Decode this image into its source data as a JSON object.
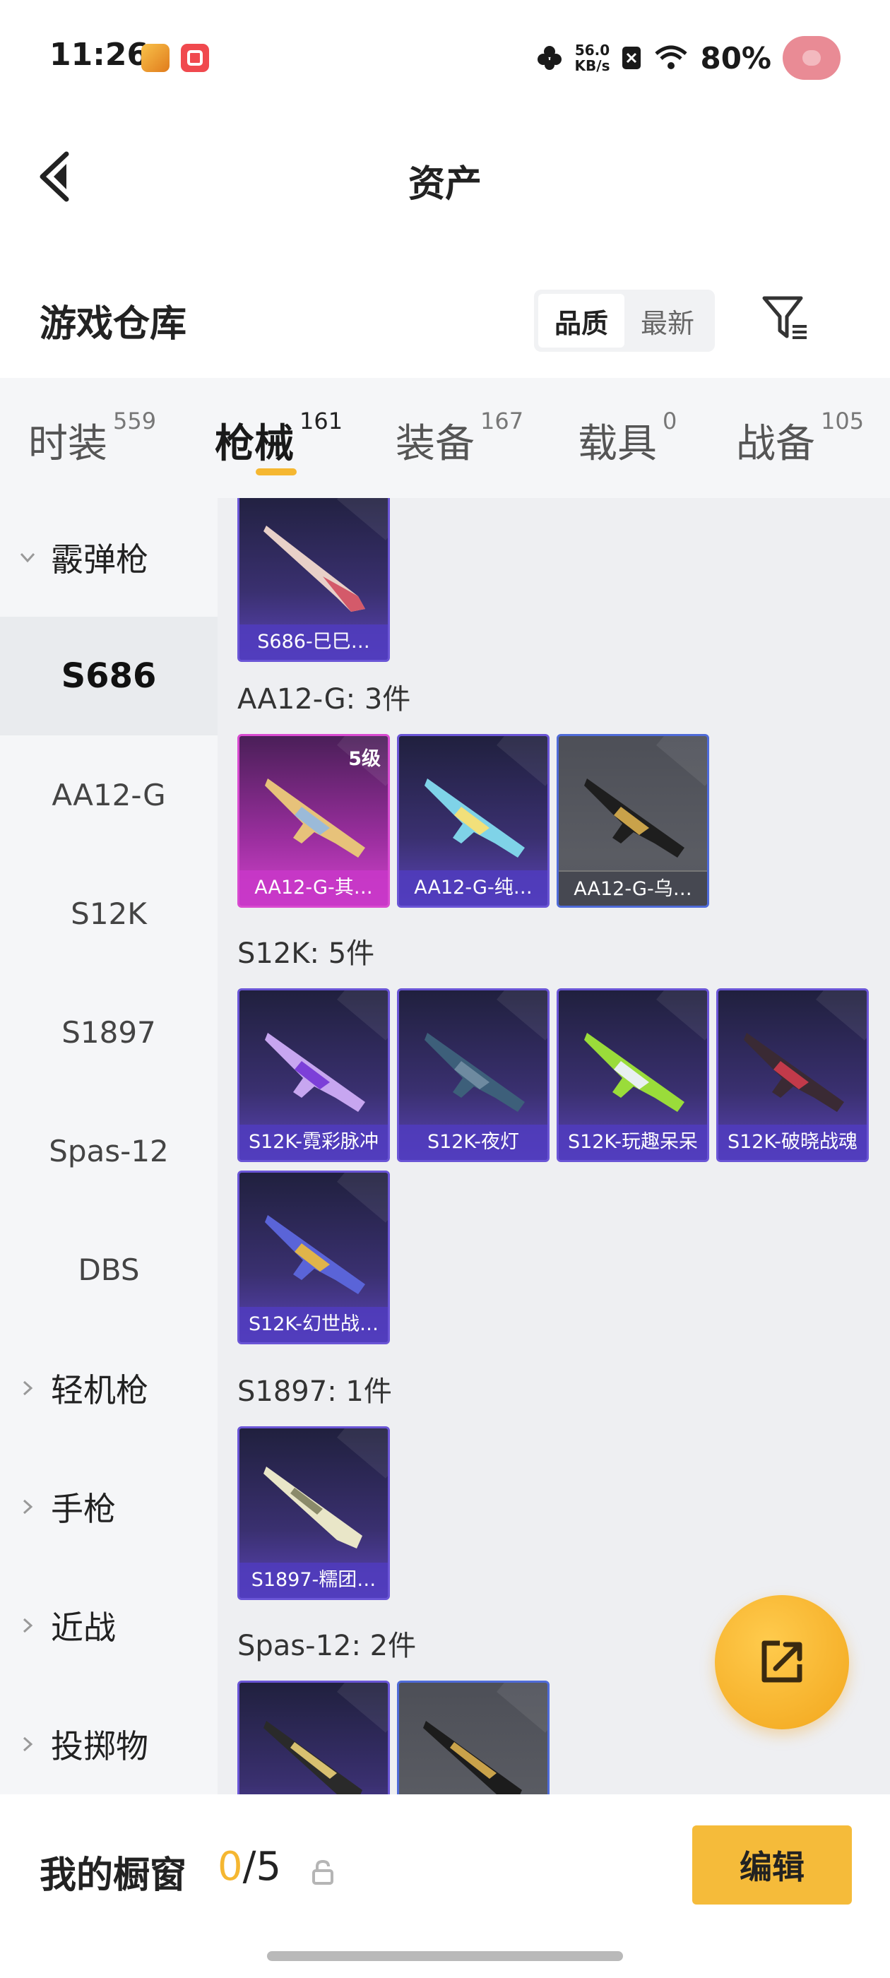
{
  "status_bar": {
    "time": "11:26",
    "net_speed_value": "56.0",
    "net_speed_unit": "KB/s",
    "battery": "80%"
  },
  "header": {
    "title": "资产",
    "back_icon": "chevron-left-icon"
  },
  "section": {
    "title": "游戏仓库",
    "sort_options": [
      "品质",
      "最新"
    ],
    "active_sort": "品质",
    "filter_icon": "filter-icon"
  },
  "tabs": [
    {
      "label": "时装",
      "count": "559"
    },
    {
      "label": "枪械",
      "count": "161"
    },
    {
      "label": "装备",
      "count": "167"
    },
    {
      "label": "载具",
      "count": "0"
    },
    {
      "label": "战备",
      "count": "105"
    }
  ],
  "active_tab": "枪械",
  "sidebar": {
    "items": [
      {
        "label": "霰弹枪",
        "kind": "category",
        "expanded": true
      },
      {
        "label": "S686",
        "kind": "sub",
        "selected": true
      },
      {
        "label": "AA12-G",
        "kind": "sub"
      },
      {
        "label": "S12K",
        "kind": "sub"
      },
      {
        "label": "S1897",
        "kind": "sub"
      },
      {
        "label": "Spas-12",
        "kind": "sub"
      },
      {
        "label": "DBS",
        "kind": "sub"
      },
      {
        "label": "轻机枪",
        "kind": "category"
      },
      {
        "label": "手枪",
        "kind": "category"
      },
      {
        "label": "近战",
        "kind": "category"
      },
      {
        "label": "投掷物",
        "kind": "category"
      }
    ]
  },
  "content": {
    "groups": [
      {
        "title": "",
        "items": [
          {
            "name": "S686-巳巳…",
            "rarity": "purple"
          }
        ]
      },
      {
        "title": "AA12-G: 3件",
        "items": [
          {
            "name": "AA12-G-其…",
            "rarity": "pink",
            "level": "5级"
          },
          {
            "name": "AA12-G-纯…",
            "rarity": "purple"
          },
          {
            "name": "AA12-G-乌…",
            "rarity": "grey"
          }
        ]
      },
      {
        "title": "S12K: 5件",
        "items": [
          {
            "name": "S12K-霓彩脉冲",
            "rarity": "purple"
          },
          {
            "name": "S12K-夜灯",
            "rarity": "purple"
          },
          {
            "name": "S12K-玩趣呆呆",
            "rarity": "purple"
          },
          {
            "name": "S12K-破晓战魂",
            "rarity": "purple"
          },
          {
            "name": "S12K-幻世战…",
            "rarity": "purple"
          }
        ]
      },
      {
        "title": "S1897: 1件",
        "items": [
          {
            "name": "S1897-糯团…",
            "rarity": "purple"
          }
        ]
      },
      {
        "title": "Spas-12: 2件",
        "items": [
          {
            "name": "",
            "rarity": "purple"
          },
          {
            "name": "",
            "rarity": "grey"
          }
        ]
      }
    ]
  },
  "fab": {
    "icon": "share-icon"
  },
  "showcase": {
    "title": "我的橱窗",
    "count_current": "0",
    "count_total": "/5",
    "lock_icon": "lock-icon",
    "edit_label": "编辑"
  },
  "colors": {
    "accent": "#f5b731",
    "rarity_purple": "#6a55d6",
    "rarity_pink": "#d84ad0"
  }
}
